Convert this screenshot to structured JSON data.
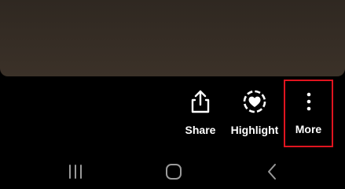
{
  "actions": {
    "share": {
      "label": "Share",
      "icon": "share-icon"
    },
    "highlight": {
      "label": "Highlight",
      "icon": "highlight-heart-icon"
    },
    "more": {
      "label": "More",
      "icon": "more-vertical-icon"
    }
  },
  "nav": {
    "recent_icon": "recent-apps-icon",
    "home_icon": "home-icon",
    "back_icon": "back-icon"
  },
  "colors": {
    "background": "#000000",
    "preview": "#352c24",
    "text": "#ffffff",
    "highlight_box": "#e0141f",
    "nav_icon": "#9a9a9a"
  }
}
